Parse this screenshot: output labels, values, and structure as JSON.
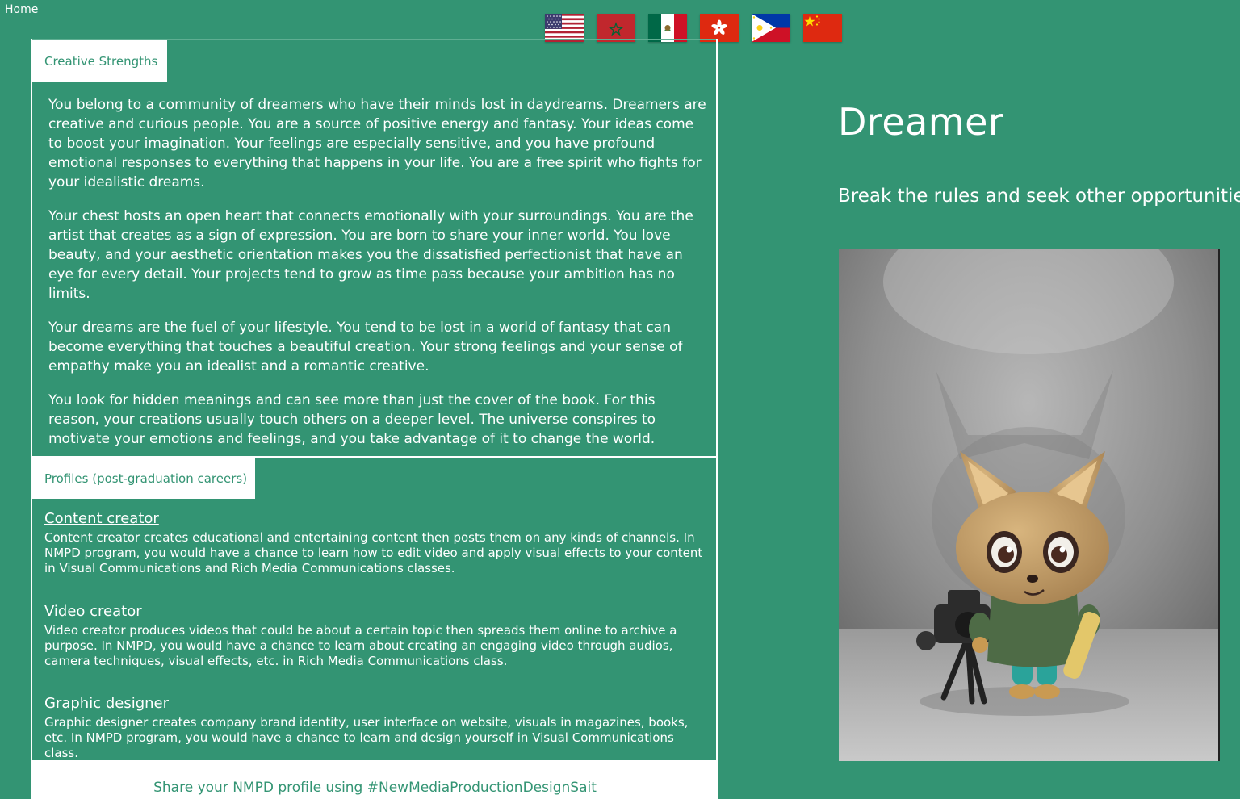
{
  "nav": {
    "home_label": "Home"
  },
  "languages": [
    {
      "icon": "us-flag-icon"
    },
    {
      "icon": "morocco-flag-icon"
    },
    {
      "icon": "mexico-flag-icon"
    },
    {
      "icon": "hong-kong-flag-icon"
    },
    {
      "icon": "philippines-flag-icon"
    },
    {
      "icon": "china-flag-icon"
    }
  ],
  "strengths": {
    "tab_label": "Creative Strengths",
    "paragraphs": [
      "You belong to a community of dreamers who have their minds lost in daydreams. Dreamers are creative and curious people. You are a source of positive energy and fantasy. Your ideas come to boost your imagination. Your feelings are especially sensitive, and you have profound emotional responses to everything that happens in your life. You are a free spirit who fights for your idealistic dreams.",
      "Your chest hosts an open heart that connects emotionally with your surroundings. You are the artist that creates as a sign of expression. You are born to share your inner world. You love beauty, and your aesthetic orientation makes you the dissatisfied perfectionist that have an eye for every detail. Your projects tend to grow as time pass because your ambition has no limits.",
      "Your dreams are the fuel of your lifestyle. You tend to be lost in a world of fantasy that can become everything that touches a beautiful creation. Your strong feelings and your sense of empathy make you an idealist and a romantic creative.",
      "You look for hidden meanings and can see more than just the cover of the book. For this reason, your creations usually touch others on a deeper level. The universe conspires to motivate your emotions and feelings, and you take advantage of it to change the world."
    ]
  },
  "profiles": {
    "tab_label": "Profiles (post-graduation careers)",
    "careers": [
      {
        "title": "Content creator",
        "description": "Content creator creates educational and entertaining content then posts them on any kinds of channels. In NMPD program, you would have a chance to learn how to edit video and apply visual effects to your content in Visual Communications and Rich Media Communications classes."
      },
      {
        "title": "Video creator",
        "description": "Video creator produces videos that could be about a certain topic then spreads them online to archive a purpose. In NMPD, you would have a chance to learn about creating an engaging video through audios, camera techniques, visual effects, etc. in Rich Media Communications class."
      },
      {
        "title": "Graphic designer",
        "description": "Graphic designer creates company brand identity, user interface on website, visuals in magazines, books, etc. In NMPD program, you would have a chance to learn and design yourself in Visual Communications class."
      }
    ]
  },
  "share": {
    "text": "Share your NMPD profile using #NewMediaProductionDesignSait"
  },
  "hero": {
    "title": "Dreamer",
    "subtitle": "Break the rules and seek other opportunities",
    "image_icon": "dreamer-mascot-illustration"
  },
  "colors": {
    "background": "#339473",
    "panel_white": "#ffffff",
    "accent_text": "#339473"
  }
}
